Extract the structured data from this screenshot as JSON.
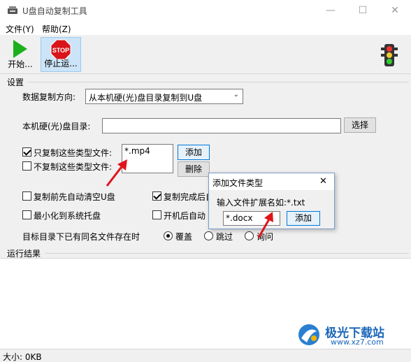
{
  "window": {
    "title": "U盘自动复制工具",
    "minimize": "—",
    "maximize": "☐",
    "close": "✕"
  },
  "menu": {
    "file": "文件(Y)",
    "help": "帮助(Z)"
  },
  "toolbar": {
    "start": "开始...",
    "stop": "停止运...",
    "stop_sign_text": "STOP"
  },
  "settings": {
    "group_title": "设置",
    "direction_label": "数据复制方向:",
    "direction_value": "从本机硬(光)盘目录复制到U盘",
    "local_dir_label": "本机硬(光)盘目录:",
    "local_dir_value": "",
    "browse_button": "选择",
    "only_copy_label": "只复制这些类型文件:",
    "only_copy_checked": true,
    "exclude_label": "不复制这些类型文件:",
    "exclude_checked": false,
    "types_list": "*.mp4",
    "add_button": "添加",
    "delete_button": "删除",
    "clear_before_label": "复制前先自动清空U盘",
    "clear_before_checked": false,
    "after_done_label": "复制完成后自",
    "after_done_checked": true,
    "minimize_tray_label": "最小化到系统托盘",
    "minimize_tray_checked": false,
    "autostart_label": "开机后自动",
    "autostart_checked": false,
    "same_name_label": "目标目录下已有同名文件存在时",
    "overwrite_label": "覆盖",
    "skip_label": "跳过",
    "ask_label": "询问",
    "same_name_choice": "overwrite"
  },
  "results": {
    "group_title": "运行结果"
  },
  "status": {
    "size_text": "大小: 0KB"
  },
  "dialog": {
    "title": "添加文件类型",
    "close": "✕",
    "prompt": "输入文件扩展名如:*.txt",
    "input_value": "*.docx",
    "add_button": "添加"
  },
  "watermark": {
    "name": "极光下载站",
    "url": "www.xz7.com"
  },
  "colors": {
    "play_green": "#1cb01c",
    "stop_red": "#d9141b",
    "arrow_red": "#e0141b",
    "selection_blue": "#cce4f7",
    "focus_blue": "#0078d7"
  }
}
